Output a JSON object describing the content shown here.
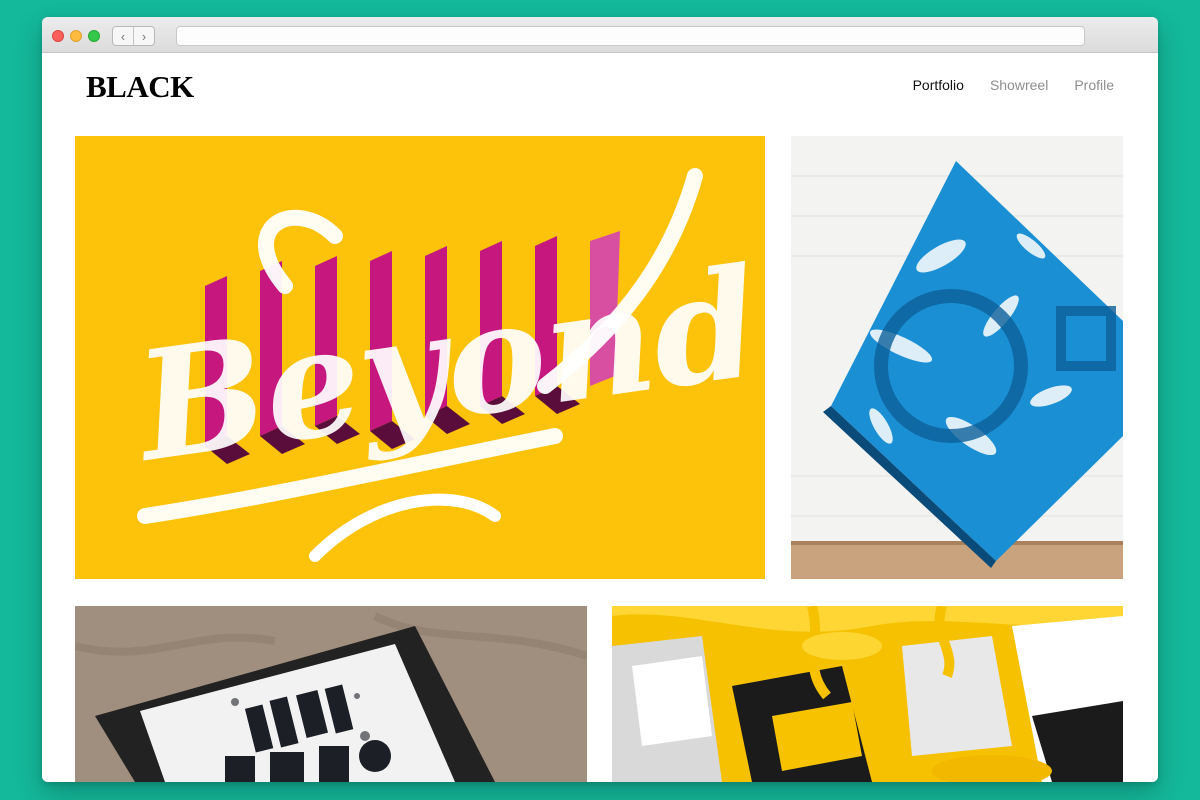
{
  "browser": {
    "back_icon": "chevron-left-icon",
    "back_glyph": "‹",
    "forward_icon": "chevron-right-icon",
    "forward_glyph": "›"
  },
  "site": {
    "logo": "BLACK"
  },
  "nav": {
    "items": [
      {
        "label": "Portfolio",
        "active": true
      },
      {
        "label": "Showreel",
        "active": false
      },
      {
        "label": "Profile",
        "active": false
      }
    ]
  },
  "portfolio": {
    "tiles": [
      {
        "name": "beyond-lettering",
        "background": "#fdc20a",
        "accent": "#c6177e"
      },
      {
        "name": "blue-marbled-sculpture",
        "background": "#f4f4f2",
        "accent": "#1a8fd4"
      },
      {
        "name": "new-york-typography-frame",
        "background": "#9b8b7b",
        "accent": "#1c1f26"
      },
      {
        "name": "yellow-paint-letters",
        "background": "#f7c300",
        "accent": "#1b1b1b"
      }
    ],
    "tile0_text": "Beyond."
  },
  "colors": {
    "page_background": "#14b89b",
    "window": "#ffffff",
    "nav_active": "#111111",
    "nav_inactive": "#8e8e8e"
  }
}
